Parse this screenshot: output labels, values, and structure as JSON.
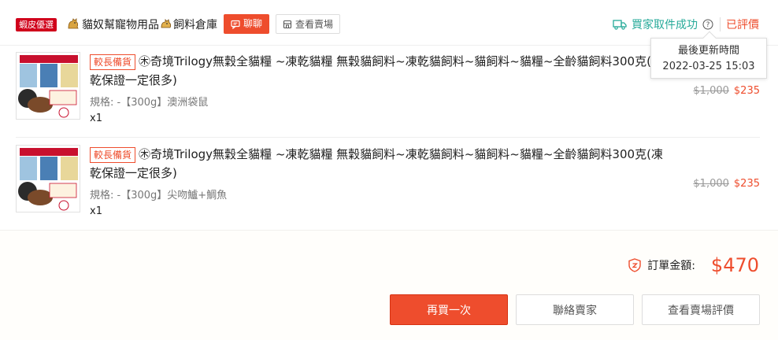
{
  "header": {
    "badge": "蝦皮優選",
    "shop_name": "貓奴幫寵物用品",
    "shop_name_2": "飼料倉庫",
    "chat_label": "聊聊",
    "view_shop_label": "查看賣場",
    "status_text": "買家取件成功",
    "rated_text": "已評價"
  },
  "tooltip": {
    "title": "最後更新時間",
    "datetime": "2022-03-25 15:03"
  },
  "items": [
    {
      "tag": "較長備貨",
      "title": "奇境Trilogy無穀全貓糧 ~凍乾貓糧 無穀貓飼料~凍乾貓飼料~貓飼料~貓糧~全齡貓飼料300克(凍乾保證一定很多)",
      "spec": "規格: -【300g】澳洲袋鼠",
      "qty": "x1",
      "orig_price": "$1,000",
      "price": "$235"
    },
    {
      "tag": "較長備貨",
      "title": "奇境Trilogy無穀全貓糧 ~凍乾貓糧 無穀貓飼料~凍乾貓飼料~貓飼料~貓糧~全齡貓飼料300克(凍乾保證一定很多)",
      "spec": "規格: -【300g】尖吻鱸+鯛魚",
      "qty": "x1",
      "orig_price": "$1,000",
      "price": "$235"
    }
  ],
  "footer": {
    "total_label": "訂單金額:",
    "total_value": "$470",
    "buy_again": "再買一次",
    "contact_seller": "聯絡賣家",
    "view_rating": "查看賣場評價"
  },
  "colors": {
    "accent": "#ee4d2d",
    "status": "#26aa99",
    "badge": "#d0011b"
  }
}
